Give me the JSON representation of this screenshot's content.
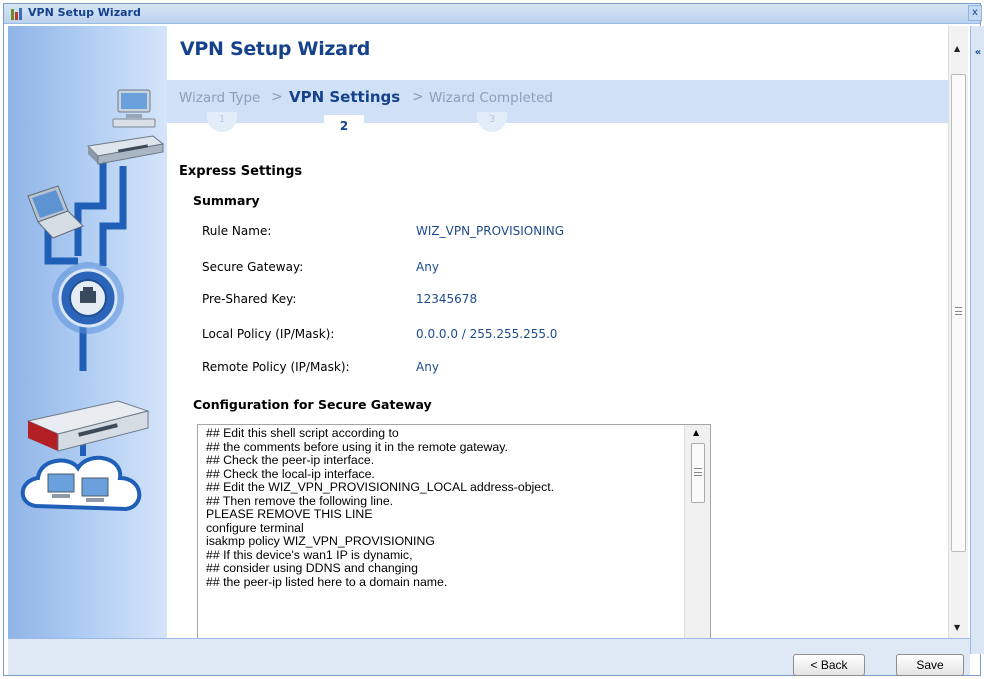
{
  "window": {
    "title": "VPN Setup Wizard",
    "close_label": "x",
    "collapse_label": "«"
  },
  "wizard": {
    "title": "VPN Setup Wizard",
    "steps": [
      {
        "label": "Wizard Type",
        "number": "1",
        "active": false
      },
      {
        "label": "VPN Settings",
        "number": "2",
        "active": true
      },
      {
        "label": "Wizard Completed",
        "number": "3",
        "active": false
      }
    ],
    "separator": ">"
  },
  "express": {
    "heading": "Express Settings",
    "summary_heading": "Summary",
    "rows": [
      {
        "label": "Rule Name:",
        "value": "WIZ_VPN_PROVISIONING"
      },
      {
        "label": "Secure Gateway:",
        "value": "Any"
      },
      {
        "label": "Pre-Shared Key:",
        "value": "12345678"
      },
      {
        "label": "Local Policy (IP/Mask):",
        "value": "0.0.0.0 / 255.255.255.0"
      },
      {
        "label": "Remote Policy (IP/Mask):",
        "value": "Any"
      }
    ],
    "config_heading": "Configuration for Secure Gateway",
    "config_text": "## Edit this shell script according to\n## the comments before using it in the remote gateway.\n## Check the peer-ip interface.\n## Check the local-ip interface.\n## Edit the WIZ_VPN_PROVISIONING_LOCAL address-object.\n## Then remove the following line.\nPLEASE REMOVE THIS LINE\nconfigure terminal\nisakmp policy WIZ_VPN_PROVISIONING\n## If this device's wan1 IP is dynamic,\n## consider using DDNS and changing\n## the peer-ip listed here to a domain name."
  },
  "footer": {
    "back_label": "< Back",
    "save_label": "Save"
  },
  "colors": {
    "accent": "#15428b",
    "value_text": "#1e4b8f",
    "steps_bar": "#cfe0f7",
    "sidebar": "#8fb4e7"
  },
  "icons": [
    "wizard-icon",
    "computer-icon",
    "switch-icon",
    "laptop-icon",
    "network-port-icon",
    "firewall-device-icon",
    "cloud-network-icon"
  ]
}
